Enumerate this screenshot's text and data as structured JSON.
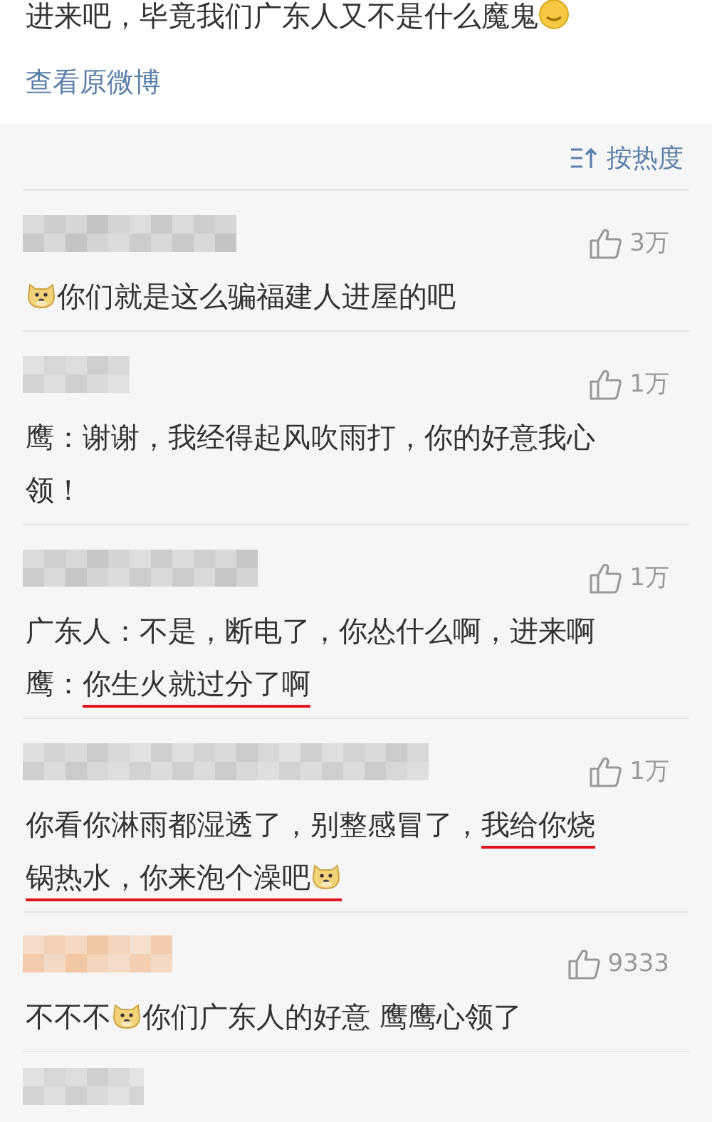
{
  "post": {
    "text_segments": [
      {
        "kind": "text",
        "text": "进来吧，毕竟我们广东人又不是什么魔鬼",
        "underlined": false
      },
      {
        "kind": "smile",
        "underlined": false
      }
    ],
    "view_original_link": "查看原微博"
  },
  "sort": {
    "label": "按热度"
  },
  "comments": [
    {
      "author": {
        "color": "#c4c4c4"
      },
      "likes": "3万",
      "lines": [
        [
          {
            "kind": "doge",
            "underlined": false
          },
          {
            "kind": "text",
            "text": "你们就是这么骗福建人进屋的吧",
            "underlined": false
          }
        ]
      ]
    },
    {
      "author": {
        "color": "#cfcfcf"
      },
      "likes": "1万",
      "lines": [
        [
          {
            "kind": "text",
            "text": "鹰：谢谢，我经得起风吹雨打，你的好意我心",
            "underlined": false
          }
        ],
        [
          {
            "kind": "text",
            "text": "领！",
            "underlined": false
          }
        ]
      ]
    },
    {
      "author": {
        "color": "#c6c6c6"
      },
      "likes": "1万",
      "lines": [
        [
          {
            "kind": "text",
            "text": "广东人：不是，断电了，你怂什么啊，进来啊",
            "underlined": false
          }
        ],
        [
          {
            "kind": "text",
            "text": "鹰：",
            "underlined": false
          },
          {
            "kind": "text",
            "text": "你生火就过分了啊",
            "underlined": true
          }
        ]
      ]
    },
    {
      "author": {
        "color": "#cbcbcb"
      },
      "likes": "1万",
      "lines": [
        [
          {
            "kind": "text",
            "text": "你看你淋雨都湿透了，别整感冒了，",
            "underlined": false
          },
          {
            "kind": "text",
            "text": "我给你烧",
            "underlined": true
          }
        ],
        [
          {
            "kind": "text",
            "text": "锅热水，你来泡个澡吧",
            "underlined": true
          },
          {
            "kind": "doge",
            "underlined": true
          }
        ]
      ]
    },
    {
      "author": {
        "color": "#f2c7a4"
      },
      "likes": "9333",
      "lines": [
        [
          {
            "kind": "text",
            "text": "不不不",
            "underlined": false
          },
          {
            "kind": "doge",
            "underlined": false
          },
          {
            "kind": "text",
            "text": " 你们广东人的好意 鹰鹰心领了",
            "underlined": false
          }
        ]
      ]
    },
    {
      "author": {
        "color": "#cfcfcf"
      }
    }
  ]
}
